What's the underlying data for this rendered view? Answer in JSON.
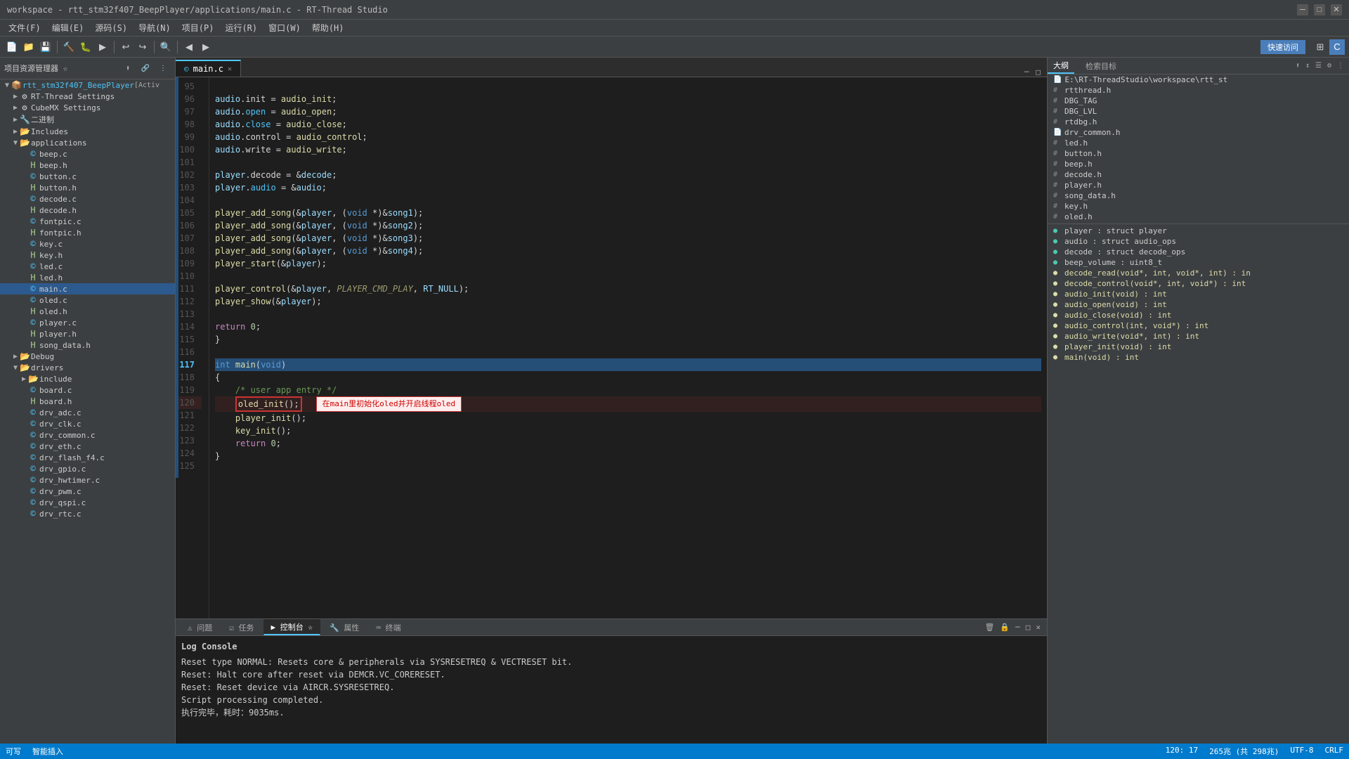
{
  "titlebar": {
    "title": "workspace - rtt_stm32f407_BeepPlayer/applications/main.c - RT-Thread Studio",
    "minimize": "─",
    "maximize": "□",
    "close": "✕"
  },
  "menubar": {
    "items": [
      "文件(F)",
      "编辑(E)",
      "源码(S)",
      "导航(N)",
      "项目(P)",
      "运行(R)",
      "窗口(W)",
      "帮助(H)"
    ]
  },
  "toolbar": {
    "quick_access": "快速访问"
  },
  "explorer": {
    "title": "项目资源管理器 ☆",
    "tree": [
      {
        "id": "root",
        "label": "rtt_stm32f407_BeepPlayer",
        "badge": "[Activ",
        "level": 0,
        "type": "project",
        "expanded": true
      },
      {
        "id": "rtthread",
        "label": "RT-Thread Settings",
        "level": 1,
        "type": "settings"
      },
      {
        "id": "cubemx",
        "label": "CubeMX Settings",
        "level": 1,
        "type": "settings"
      },
      {
        "id": "binary",
        "label": "二进制",
        "level": 1,
        "type": "folder"
      },
      {
        "id": "includes",
        "label": "Includes",
        "level": 1,
        "type": "folder",
        "expanded": false
      },
      {
        "id": "applications",
        "label": "applications",
        "level": 1,
        "type": "folder",
        "expanded": true
      },
      {
        "id": "beep_c",
        "label": "beep.c",
        "level": 2,
        "type": "c"
      },
      {
        "id": "beep_h",
        "label": "beep.h",
        "level": 2,
        "type": "h"
      },
      {
        "id": "button_c",
        "label": "button.c",
        "level": 2,
        "type": "c"
      },
      {
        "id": "button_h",
        "label": "button.h",
        "level": 2,
        "type": "h"
      },
      {
        "id": "decode_c",
        "label": "decode.c",
        "level": 2,
        "type": "c"
      },
      {
        "id": "decode_h",
        "label": "decode.h",
        "level": 2,
        "type": "h"
      },
      {
        "id": "fontpic_c",
        "label": "fontpic.c",
        "level": 2,
        "type": "c"
      },
      {
        "id": "fontpic_h",
        "label": "fontpic.h",
        "level": 2,
        "type": "h"
      },
      {
        "id": "key_c",
        "label": "key.c",
        "level": 2,
        "type": "c"
      },
      {
        "id": "key_h",
        "label": "key.h",
        "level": 2,
        "type": "h"
      },
      {
        "id": "led_c",
        "label": "led.c",
        "level": 2,
        "type": "c"
      },
      {
        "id": "led_h",
        "label": "led.h",
        "level": 2,
        "type": "h"
      },
      {
        "id": "main_c",
        "label": "main.c",
        "level": 2,
        "type": "c",
        "active": true
      },
      {
        "id": "oled_c",
        "label": "oled.c",
        "level": 2,
        "type": "c"
      },
      {
        "id": "oled_h",
        "label": "oled.h",
        "level": 2,
        "type": "h"
      },
      {
        "id": "player_c",
        "label": "player.c",
        "level": 2,
        "type": "c"
      },
      {
        "id": "player_h",
        "label": "player.h",
        "level": 2,
        "type": "h"
      },
      {
        "id": "song_data_h",
        "label": "song_data.h",
        "level": 2,
        "type": "h"
      },
      {
        "id": "debug",
        "label": "Debug",
        "level": 1,
        "type": "folder",
        "expanded": false
      },
      {
        "id": "drivers",
        "label": "drivers",
        "level": 1,
        "type": "folder",
        "expanded": true
      },
      {
        "id": "include2",
        "label": "include",
        "level": 2,
        "type": "folder",
        "expanded": false
      },
      {
        "id": "board_c",
        "label": "board.c",
        "level": 2,
        "type": "c"
      },
      {
        "id": "board_h",
        "label": "board.h",
        "level": 2,
        "type": "h"
      },
      {
        "id": "drv_adc_c",
        "label": "drv_adc.c",
        "level": 2,
        "type": "c"
      },
      {
        "id": "drv_clk_c",
        "label": "drv_clk.c",
        "level": 2,
        "type": "c"
      },
      {
        "id": "drv_common_c",
        "label": "drv_common.c",
        "level": 2,
        "type": "c"
      },
      {
        "id": "drv_eth_c",
        "label": "drv_eth.c",
        "level": 2,
        "type": "c"
      },
      {
        "id": "drv_flash_f4_c",
        "label": "drv_flash_f4.c",
        "level": 2,
        "type": "c"
      },
      {
        "id": "drv_gpio_c",
        "label": "drv_gpio.c",
        "level": 2,
        "type": "c"
      },
      {
        "id": "drv_hwtimer_c",
        "label": "drv_hwtimer.c",
        "level": 2,
        "type": "c"
      },
      {
        "id": "drv_pwm_c",
        "label": "drv_pwm.c",
        "level": 2,
        "type": "c"
      },
      {
        "id": "drv_qspi_c",
        "label": "drv_qspi.c",
        "level": 2,
        "type": "c"
      },
      {
        "id": "drv_rtc_c",
        "label": "drv_rtc.c",
        "level": 2,
        "type": "c"
      }
    ]
  },
  "editor": {
    "tab_label": "main.c",
    "lines": [
      {
        "num": 95,
        "code": ""
      },
      {
        "num": 96,
        "code": "    audio.init = audio_init;"
      },
      {
        "num": 97,
        "code": "    audio.open = audio_open;"
      },
      {
        "num": 98,
        "code": "    audio.close = audio_close;"
      },
      {
        "num": 99,
        "code": "    audio.control = audio_control;"
      },
      {
        "num": 100,
        "code": "    audio.write = audio_write;"
      },
      {
        "num": 101,
        "code": ""
      },
      {
        "num": 102,
        "code": "    player.decode = &decode;"
      },
      {
        "num": 103,
        "code": "    player.audio = &audio;"
      },
      {
        "num": 104,
        "code": ""
      },
      {
        "num": 105,
        "code": "    player_add_song(&player, (void *)&song1);"
      },
      {
        "num": 106,
        "code": "    player_add_song(&player, (void *)&song2);"
      },
      {
        "num": 107,
        "code": "    player_add_song(&player, (void *)&song3);"
      },
      {
        "num": 108,
        "code": "    player_add_song(&player, (void *)&song4);"
      },
      {
        "num": 109,
        "code": "    player_start(&player);"
      },
      {
        "num": 110,
        "code": ""
      },
      {
        "num": 111,
        "code": "    player_control(&player, PLAYER_CMD_PLAY, RT_NULL);"
      },
      {
        "num": 112,
        "code": "    player_show(&player);"
      },
      {
        "num": 113,
        "code": ""
      },
      {
        "num": 114,
        "code": "    return 0;"
      },
      {
        "num": 115,
        "code": "}"
      },
      {
        "num": 116,
        "code": ""
      },
      {
        "num": 117,
        "code": "int main(void)"
      },
      {
        "num": 118,
        "code": "{"
      },
      {
        "num": 119,
        "code": "    /* user app entry */"
      },
      {
        "num": 120,
        "code": "    oled_init();",
        "highlight": true,
        "annotation": "在main里初始化oled并开启线程oled"
      },
      {
        "num": 121,
        "code": "    player_init();"
      },
      {
        "num": 122,
        "code": "    key_init();"
      },
      {
        "num": 123,
        "code": "    return 0;"
      },
      {
        "num": 124,
        "code": "}"
      },
      {
        "num": 125,
        "code": ""
      }
    ]
  },
  "outline": {
    "title": "大纲",
    "search_title": "检索目标",
    "items": [
      {
        "text": "E:\\RT-ThreadStudio\\workspace\\rtt_st",
        "type": "path",
        "icon": "📄"
      },
      {
        "text": "rtthread.h",
        "type": "include",
        "icon": "#"
      },
      {
        "text": "DBG_TAG",
        "type": "define",
        "icon": "#"
      },
      {
        "text": "DBG_LVL",
        "type": "define",
        "icon": "#"
      },
      {
        "text": "rtdbg.h",
        "type": "include",
        "icon": "#"
      },
      {
        "text": "drv_common.h",
        "type": "include",
        "icon": "📄"
      },
      {
        "text": "led.h",
        "type": "include",
        "icon": "#"
      },
      {
        "text": "button.h",
        "type": "include",
        "icon": "#"
      },
      {
        "text": "beep.h",
        "type": "include",
        "icon": "#"
      },
      {
        "text": "decode.h",
        "type": "include",
        "icon": "#"
      },
      {
        "text": "player.h",
        "type": "include",
        "icon": "#"
      },
      {
        "text": "song_data.h",
        "type": "include",
        "icon": "#"
      },
      {
        "text": "key.h",
        "type": "include",
        "icon": "#"
      },
      {
        "text": "oled.h",
        "type": "include",
        "icon": "#"
      },
      {
        "text": "player : struct player",
        "type": "var",
        "icon": "●"
      },
      {
        "text": "audio : struct audio_ops",
        "type": "var",
        "icon": "●"
      },
      {
        "text": "decode : struct decode_ops",
        "type": "var",
        "icon": "●"
      },
      {
        "text": "beep_volume : uint8_t",
        "type": "var",
        "icon": "●"
      },
      {
        "text": "decode_read(void*, int, void*, int) : in",
        "type": "func",
        "icon": "●"
      },
      {
        "text": "decode_control(void*, int, void*) : int",
        "type": "func",
        "icon": "●"
      },
      {
        "text": "audio_init(void) : int",
        "type": "func",
        "icon": "●"
      },
      {
        "text": "audio_open(void) : int",
        "type": "func",
        "icon": "●"
      },
      {
        "text": "audio_close(void) : int",
        "type": "func",
        "icon": "●"
      },
      {
        "text": "audio_control(int, void*) : int",
        "type": "func",
        "icon": "●"
      },
      {
        "text": "audio_write(void*, int) : int",
        "type": "func",
        "icon": "●"
      },
      {
        "text": "player_init(void) : int",
        "type": "func",
        "icon": "●"
      },
      {
        "text": "main(void) : int",
        "type": "func",
        "icon": "●"
      }
    ]
  },
  "bottom": {
    "tabs": [
      "问题",
      "任务",
      "控制台",
      "属性",
      "终端"
    ],
    "active_tab": "控制台",
    "console_title": "Log Console",
    "console_lines": [
      "Reset type NORMAL: Resets core & peripherals via SYSRESETREQ & VECTRESET bit.",
      "Reset: Halt core after reset via DEMCR.VC_CORERESET.",
      "Reset: Reset device via AIRCR.SYSRESETREQ.",
      "Script processing completed.",
      "执行完毕，耗时：9035ms."
    ]
  },
  "statusbar": {
    "writeable": "可写",
    "insert_mode": "智能插入",
    "position": "120: 17",
    "file_size": "265兆 (共 298兆)",
    "encoding": "UTF-8",
    "line_ending": "CRLF"
  }
}
